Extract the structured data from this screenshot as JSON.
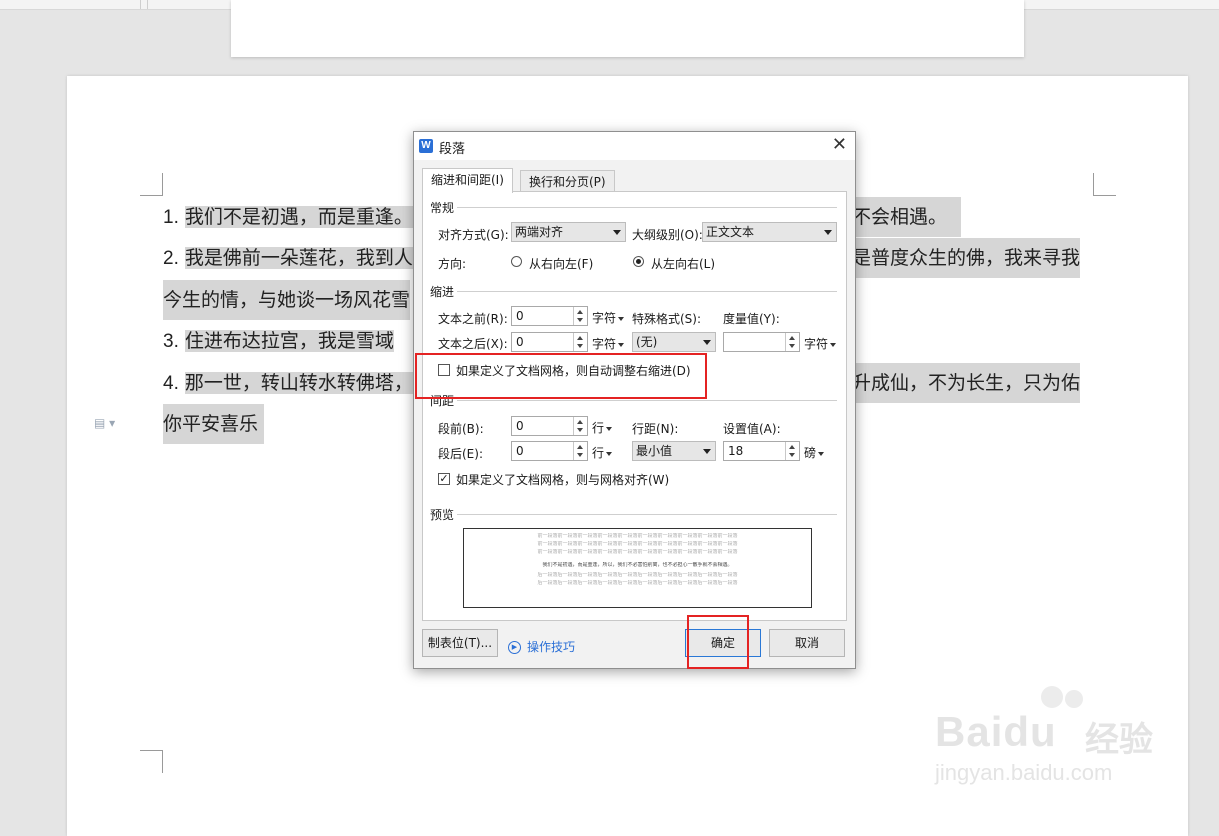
{
  "document": {
    "lines": [
      {
        "num": "1.",
        "text": "我们不是初遇，而是重逢。"
      },
      {
        "num": "",
        "text": "不会相遇。"
      },
      {
        "num": "2.",
        "text": "我是佛前一朵莲花，我到人"
      },
      {
        "num": "",
        "text": "是普度众生的佛，我来寻我"
      },
      {
        "num": "",
        "text": "今生的情，与她谈一场风花雪"
      },
      {
        "num": "3.",
        "text": "住进布达拉宫，我是雪域"
      },
      {
        "num": "4.",
        "text": "那一世，转山转水转佛塔，"
      },
      {
        "num": "",
        "text": "升成仙，不为长生，只为佑"
      },
      {
        "num": "",
        "text": "你平安喜乐"
      }
    ]
  },
  "dialog": {
    "title": "段落",
    "app_icon": "W",
    "tabs": [
      {
        "label": "缩进和间距(I)",
        "active": true
      },
      {
        "label": "换行和分页(P)",
        "active": false
      }
    ],
    "general": {
      "header": "常规",
      "alignment_label": "对齐方式(G):",
      "alignment_value": "两端对齐",
      "outline_label": "大纲级别(O):",
      "outline_value": "正文文本",
      "direction_label": "方向:",
      "rtl_label": "从右向左(F)",
      "ltr_label": "从左向右(L)"
    },
    "indent": {
      "header": "缩进",
      "before_label": "文本之前(R):",
      "before_value": "0",
      "before_unit": "字符",
      "after_label": "文本之后(X):",
      "after_value": "0",
      "after_unit": "字符",
      "special_label": "特殊格式(S):",
      "special_value": "(无)",
      "measure_label": "度量值(Y):",
      "measure_value": "",
      "measure_unit": "字符",
      "auto_adjust_label": "如果定义了文档网格，则自动调整右缩进(D)",
      "auto_adjust_checked": false
    },
    "spacing": {
      "header": "间距",
      "before_label": "段前(B):",
      "before_value": "0",
      "before_unit": "行",
      "after_label": "段后(E):",
      "after_value": "0",
      "after_unit": "行",
      "line_label": "行距(N):",
      "line_value": "最小值",
      "setting_label": "设置值(A):",
      "setting_value": "18",
      "setting_unit": "磅",
      "grid_align_label": "如果定义了文档网格，则与网格对齐(W)",
      "grid_align_checked": true,
      "check_mark": "✓"
    },
    "preview": {
      "header": "预览",
      "before_lines": [
        "前一段落前一段落前一段落前一段落前一段落前一段落前一段落前一段落前一段落前一段落",
        "前一段落前一段落前一段落前一段落前一段落前一段落前一段落前一段落前一段落前一段落",
        "前一段落前一段落前一段落前一段落前一段落前一段落前一段落前一段落前一段落前一段落"
      ],
      "main_line": "我们不是初遇，而是重逢，所以，我们不必害怕别离，也不必担心一散手就不会相遇。",
      "after_lines": [
        "后一段落后一段落后一段落后一段落后一段落后一段落后一段落后一段落后一段落后一段落",
        "后一段落后一段落后一段落后一段落后一段落后一段落后一段落后一段落后一段落后一段落"
      ]
    },
    "buttons": {
      "tabs_label": "制表位(T)...",
      "tips_label": "操作技巧",
      "ok_label": "确定",
      "cancel_label": "取消"
    }
  },
  "watermark": {
    "brand": "Bai",
    "brand2": "du",
    "cn": "经验",
    "url": "jingyan.baidu.com"
  },
  "colors": {
    "highlight": "#d6d6d6",
    "annotation_red": "#e42323",
    "accent_blue": "#2a6fd6"
  }
}
